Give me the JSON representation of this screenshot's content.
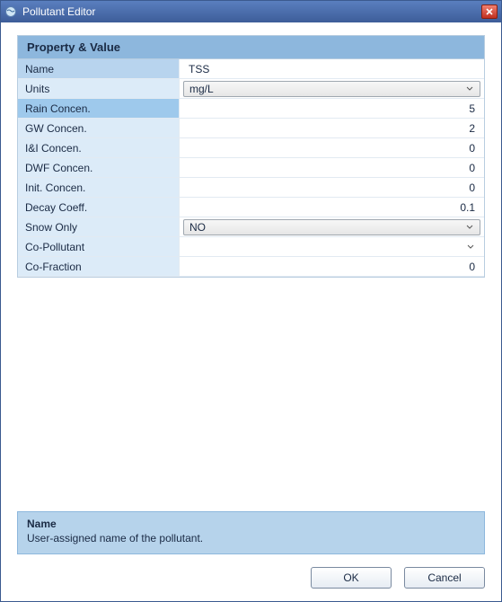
{
  "window": {
    "title": "Pollutant Editor"
  },
  "grid": {
    "header": "Property  &  Value",
    "rows": [
      {
        "label": "Name",
        "value": "TSS",
        "type": "text",
        "selected": false,
        "nameRow": true
      },
      {
        "label": "Units",
        "value": "mg/L",
        "type": "dropdown",
        "selected": false
      },
      {
        "label": "Rain Concen.",
        "value": "5",
        "type": "number",
        "selected": true
      },
      {
        "label": "GW Concen.",
        "value": "2",
        "type": "number"
      },
      {
        "label": "I&I Concen.",
        "value": "0",
        "type": "number"
      },
      {
        "label": "DWF Concen.",
        "value": "0",
        "type": "number"
      },
      {
        "label": "Init. Concen.",
        "value": "0",
        "type": "number"
      },
      {
        "label": "Decay Coeff.",
        "value": "0.1",
        "type": "number"
      },
      {
        "label": "Snow Only",
        "value": "NO",
        "type": "dropdown"
      },
      {
        "label": "Co-Pollutant",
        "value": "",
        "type": "dropdown-plain"
      },
      {
        "label": "Co-Fraction",
        "value": "0",
        "type": "number"
      }
    ]
  },
  "help": {
    "title": "Name",
    "desc": "User-assigned name of the pollutant."
  },
  "buttons": {
    "ok": "OK",
    "cancel": "Cancel"
  }
}
